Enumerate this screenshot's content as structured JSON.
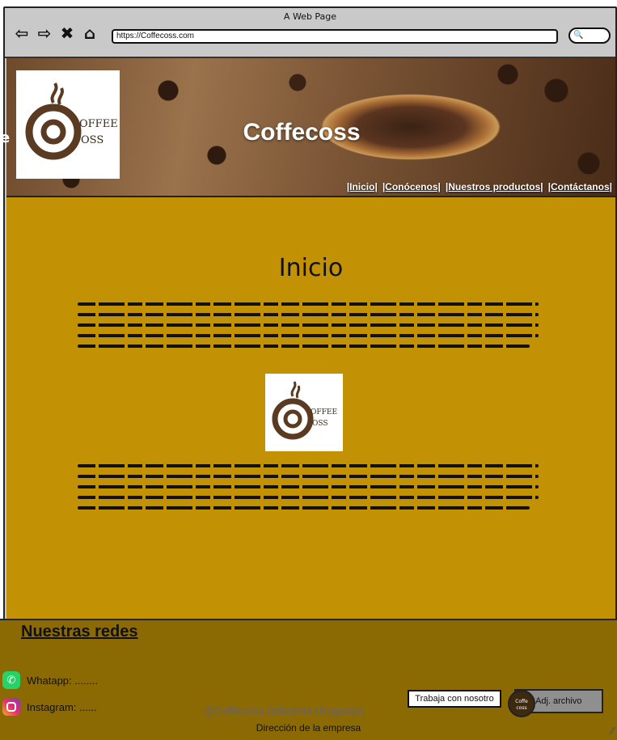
{
  "browser": {
    "window_title": "A Web Page",
    "url": "https://Coffecoss.com",
    "icons": [
      "back-icon",
      "forward-icon",
      "close-icon",
      "home-icon",
      "search-icon"
    ]
  },
  "header": {
    "title": "Coffecoss",
    "nav": [
      "|Inicio|",
      "|Conócenos|",
      "|Nuestros productos|",
      "|Contáctanos|"
    ],
    "logo_text_top": "OFFEE",
    "logo_text_bottom": "OSS"
  },
  "main": {
    "heading": "Inicio",
    "logo_text_top": "OFFEE",
    "logo_text_bottom": "OSS",
    "background_color": "#c39104"
  },
  "footer": {
    "title": "Nuestras redes",
    "whatsapp": "Whatapp: ........",
    "instagram": "Instagram: ......",
    "tagline": "@Coffecoss  Industria Uruguaya",
    "address": "Dirección de la empresa",
    "work_button": "Trabaja con nosotro",
    "attach_button": "Adj. archivo",
    "mini_logo_text": "Coffe coss"
  }
}
